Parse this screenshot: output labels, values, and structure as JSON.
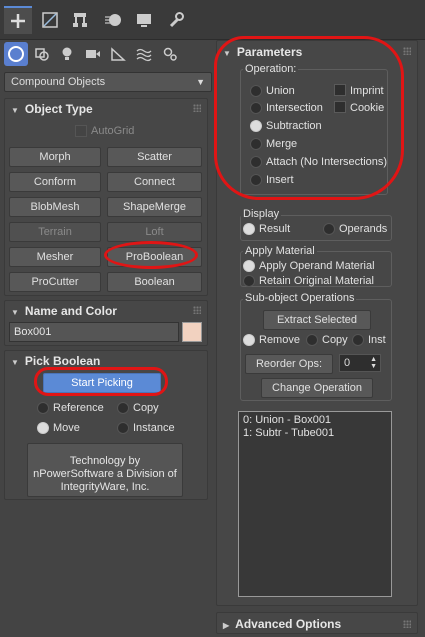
{
  "top_tabs": [
    "create-tab",
    "modify-tab",
    "hierarchy-tab",
    "motion-tab",
    "display-tab",
    "utilities-tab"
  ],
  "category_dropdown": {
    "value": "Compound Objects"
  },
  "object_type": {
    "title": "Object Type",
    "autogrid": "AutoGrid",
    "buttons": [
      "Morph",
      "Scatter",
      "Conform",
      "Connect",
      "BlobMesh",
      "ShapeMerge",
      "Terrain",
      "Loft",
      "Mesher",
      "ProBoolean",
      "ProCutter",
      "Boolean"
    ]
  },
  "name_color": {
    "title": "Name and Color",
    "name": "Box001",
    "color": "#f2d2c0"
  },
  "pick_boolean": {
    "title": "Pick Boolean",
    "start_picking": "Start Picking",
    "options": [
      "Reference",
      "Copy",
      "Move",
      "Instance"
    ],
    "tech_text": "Technology by nPowerSoftware a Division of IntegrityWare, Inc."
  },
  "parameters": {
    "title": "Parameters",
    "operation_title": "Operation:",
    "operations": [
      "Union",
      "Intersection",
      "Subtraction",
      "Merge",
      "Attach (No Intersections)",
      "Insert"
    ],
    "checks": [
      "Imprint",
      "Cookie"
    ],
    "display_title": "Display",
    "display_options": [
      "Result",
      "Operands"
    ],
    "apply_title": "Apply Material",
    "apply_options": [
      "Apply Operand Material",
      "Retain Original Material"
    ],
    "subobj_title": "Sub-object Operations",
    "extract_btn": "Extract Selected",
    "extract_options": [
      "Remove",
      "Copy",
      "Inst"
    ],
    "reorder_btn": "Reorder Ops:",
    "reorder_value": "0",
    "change_btn": "Change Operation",
    "list": [
      "0: Union - Box001",
      "1: Subtr - Tube001"
    ]
  },
  "advanced": {
    "title": "Advanced Options"
  },
  "accent": "#5b8ad6",
  "annotation_color": "#e01515"
}
